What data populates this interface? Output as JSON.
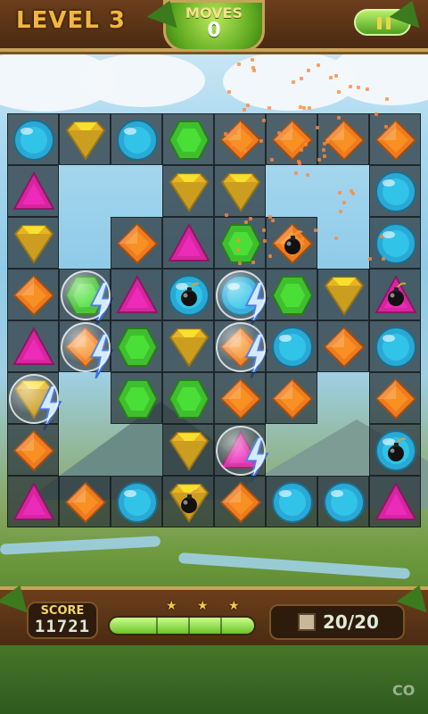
{
  "header": {
    "level_label": "LEVEL",
    "level_number": "3",
    "moves_label": "MOVES",
    "moves_value": "0"
  },
  "footer": {
    "score_label": "SCORE",
    "score_value": "11721",
    "tiles_value": "20/20",
    "stars_count": 3,
    "progress": 1.0
  },
  "watermark": "CO",
  "colors": {
    "blue": "#2aa9d6",
    "gold": "#e8b425",
    "green": "#3fbf2e",
    "orange": "#f07a1e",
    "magenta": "#d8249e",
    "cell": "#283237"
  },
  "board": {
    "rows": 8,
    "cols": 8,
    "grid": [
      [
        "blue",
        "gold",
        "blue",
        "green",
        "orange",
        "orange",
        "orange",
        "orange"
      ],
      [
        "magenta",
        "empty",
        "empty",
        "gold",
        "gold",
        "empty",
        "empty",
        "blue"
      ],
      [
        "gold",
        "empty",
        "orange",
        "magenta",
        "green",
        "orange-bomb",
        "empty",
        "blue"
      ],
      [
        "orange",
        "green-bubble",
        "magenta",
        "blue-bomb",
        "blue-bubble",
        "green",
        "gold",
        "magenta-bomb"
      ],
      [
        "magenta",
        "orange-bubble",
        "green",
        "gold",
        "orange-bubble",
        "blue",
        "orange",
        "blue"
      ],
      [
        "gold-bubble",
        "empty",
        "green",
        "green",
        "orange",
        "orange",
        "empty",
        "orange"
      ],
      [
        "orange",
        "empty",
        "empty",
        "gold",
        "magenta-bubble",
        "empty",
        "empty",
        "blue-bomb"
      ],
      [
        "magenta",
        "orange",
        "blue",
        "gold-bomb",
        "orange",
        "blue",
        "blue",
        "magenta"
      ]
    ]
  }
}
